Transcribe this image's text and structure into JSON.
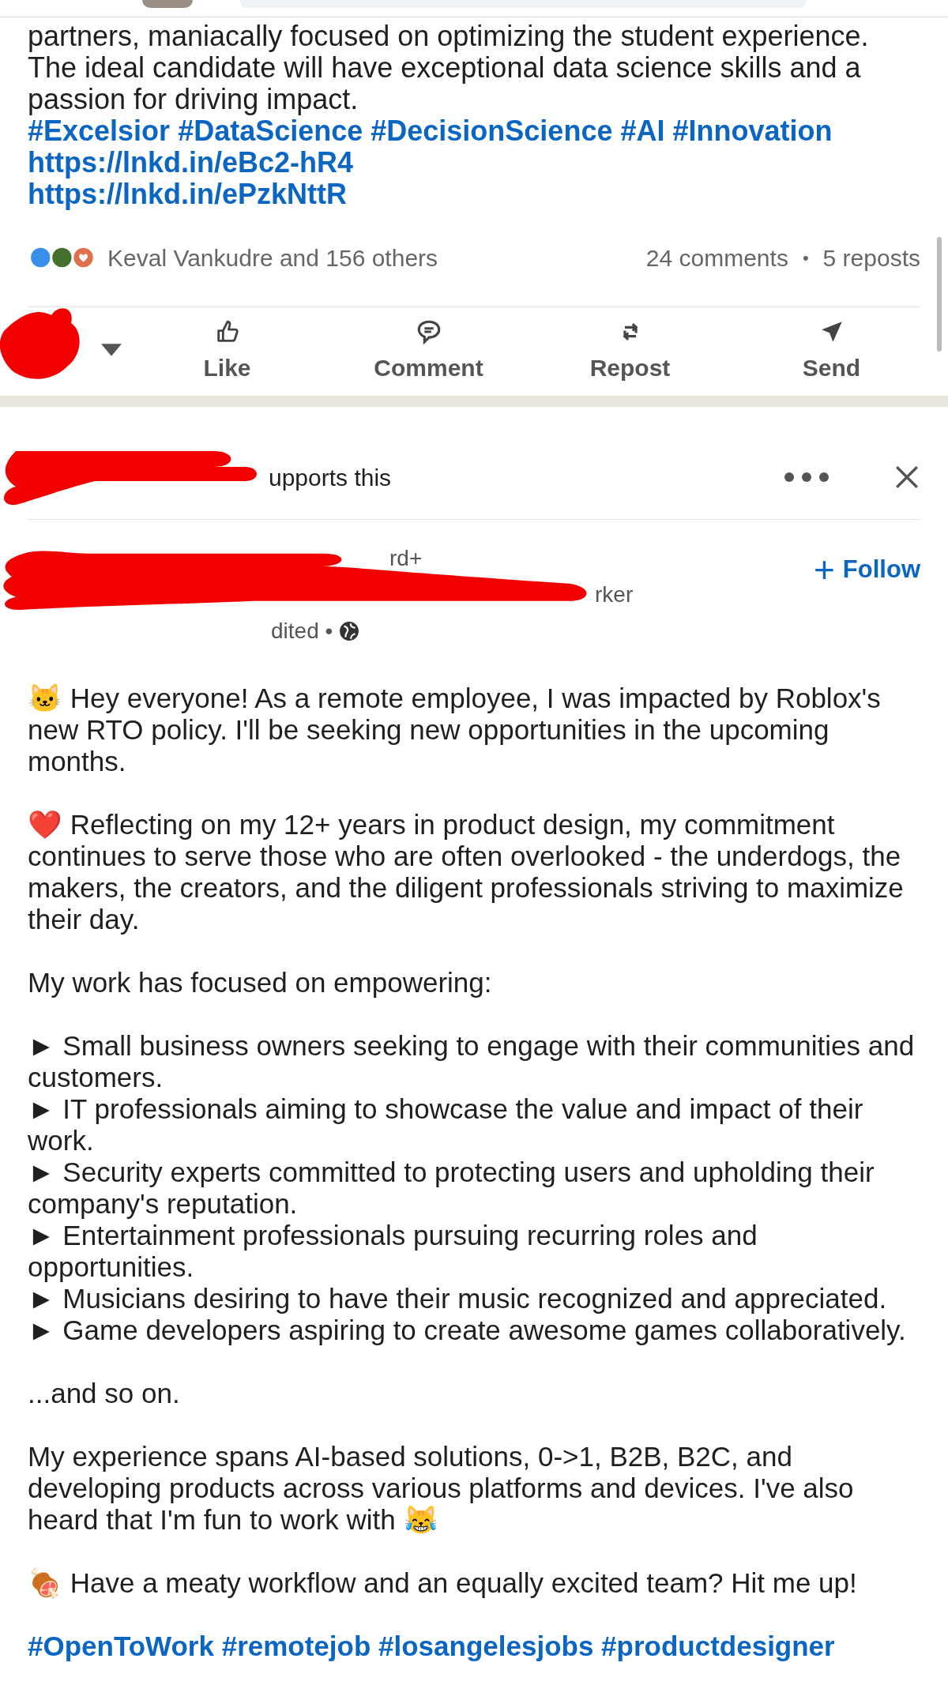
{
  "post_top": {
    "text_lines": [
      "partners, maniacally focused on optimizing the student experience.",
      "The ideal candidate will have exceptional data science skills and a",
      "passion for driving impact."
    ],
    "hashtags": "#Excelsior #DataScience #DecisionScience #AI #Innovation",
    "links": [
      "https://lnkd.in/eBc2-hR4",
      "https://lnkd.in/ePzkNttR"
    ],
    "reactions_text": "Keval Vankudre and 156 others",
    "comments": "24 comments",
    "separator": "•",
    "reposts": "5 reposts",
    "actions": [
      {
        "label": "Like",
        "kind": "like"
      },
      {
        "label": "Comment",
        "kind": "comment"
      },
      {
        "label": "Repost",
        "kind": "repost"
      },
      {
        "label": "Send",
        "kind": "send"
      }
    ]
  },
  "post": {
    "context": "upports this",
    "author_degree": "rd+",
    "author_headline": "rker",
    "meta": "dited •",
    "follow": "Follow",
    "follow_icon": "+",
    "body": [
      {
        "kind": "paragraph",
        "text": "🐱 Hey everyone! As a remote employee, I was impacted by Roblox's new RTO policy. I'll be seeking new opportunities in the upcoming months."
      },
      {
        "kind": "paragraph",
        "text": "❤️ Reflecting on my 12+ years in product design, my commitment continues to serve those who are often overlooked - the underdogs, the makers, the creators, and the diligent professionals striving to maximize their day."
      },
      {
        "kind": "paragraph",
        "text": "My work has focused on empowering:"
      },
      {
        "kind": "bullets",
        "items": [
          "► Small business owners seeking to engage with their communities and customers.",
          "► IT professionals aiming to showcase the value and impact of their work.",
          "► Security experts committed to protecting users and upholding their company's reputation.",
          "► Entertainment professionals pursuing recurring roles and opportunities.",
          "► Musicians desiring to have their music recognized and appreciated.",
          "► Game developers aspiring to create awesome games collaboratively."
        ]
      },
      {
        "kind": "paragraph",
        "text": "...and so on."
      },
      {
        "kind": "paragraph",
        "text": "My experience spans AI-based solutions, 0->1, B2B, B2C, and developing products across various platforms and devices. I've also heard that I'm fun to work with 😹"
      },
      {
        "kind": "paragraph",
        "text": "🍖 Have a meaty workflow and an equally excited team? Hit me up!"
      },
      {
        "kind": "hashtags",
        "text": "#OpenToWork #remotejob #losangelesjobs #productdesigner"
      }
    ]
  }
}
